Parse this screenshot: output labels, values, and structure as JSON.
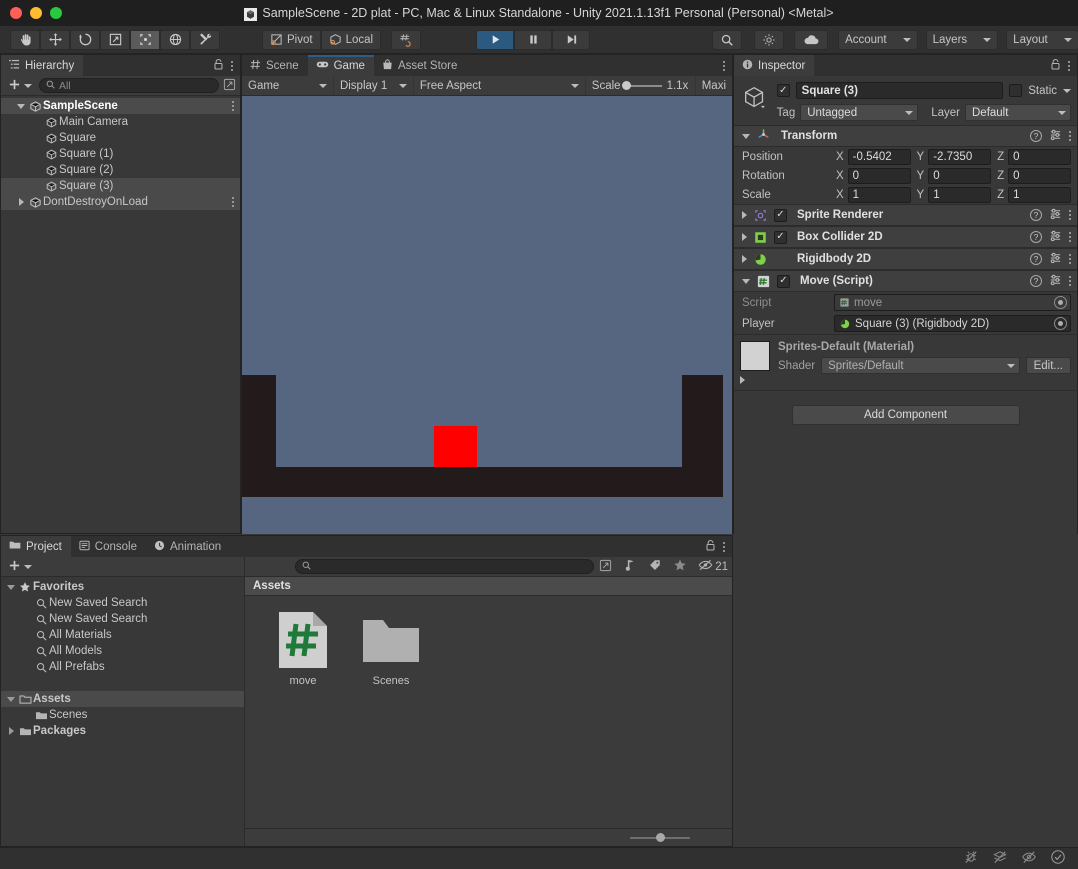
{
  "window": {
    "title": "SampleScene - 2D plat - PC, Mac & Linux Standalone - Unity 2021.1.13f1 Personal (Personal) <Metal>"
  },
  "toolbar": {
    "tools": [
      "hand-tool",
      "move-tool",
      "rotate-tool",
      "scale-tool",
      "rect-tool",
      "transform-tool",
      "custom-tool"
    ],
    "active_tool": "rect-tool",
    "pivot_label": "Pivot",
    "local_label": "Local",
    "snap_label": "grid-snap",
    "play_label": "play",
    "pause_label": "pause",
    "step_label": "step",
    "search_label": "search",
    "layers_label": "Layers",
    "layout_label": "Layout",
    "account_label": "Account",
    "cloud_label": "cloud",
    "services_label": "services"
  },
  "hierarchy": {
    "tab_label": "Hierarchy",
    "search_placeholder": "All",
    "create_label": "+",
    "items": [
      {
        "label": "SampleScene",
        "icon": "unity-scene-icon",
        "depth": 1,
        "expander": "down",
        "selected": true,
        "bold": true,
        "kebab": true
      },
      {
        "label": "Main Camera",
        "icon": "gameobject-icon",
        "depth": 2,
        "expander": "none",
        "selected": false,
        "bold": false,
        "kebab": false
      },
      {
        "label": "Square",
        "icon": "gameobject-icon",
        "depth": 2,
        "expander": "none",
        "selected": false,
        "bold": false,
        "kebab": false
      },
      {
        "label": "Square (1)",
        "icon": "gameobject-icon",
        "depth": 2,
        "expander": "none",
        "selected": false,
        "bold": false,
        "kebab": false
      },
      {
        "label": "Square (2)",
        "icon": "gameobject-icon",
        "depth": 2,
        "expander": "none",
        "selected": false,
        "bold": false,
        "kebab": false
      },
      {
        "label": "Square (3)",
        "icon": "gameobject-icon",
        "depth": 2,
        "expander": "none",
        "selected": true,
        "bold": false,
        "kebab": false
      },
      {
        "label": "DontDestroyOnLoad",
        "icon": "unity-scene-icon",
        "depth": 1,
        "expander": "right",
        "selected": true,
        "bold": false,
        "kebab": true
      }
    ]
  },
  "gameview": {
    "tabs": [
      {
        "label": "Scene",
        "icon": "scene-grid-icon",
        "active": false
      },
      {
        "label": "Game",
        "icon": "gamepad-icon",
        "active": true
      },
      {
        "label": "Asset Store",
        "icon": "store-icon",
        "active": false
      }
    ],
    "controls": {
      "display_mode": "Game",
      "display_number": "Display 1",
      "aspect": "Free Aspect",
      "scale_label": "Scale",
      "scale_value": "1.1x",
      "maximize_label": "Maxi"
    },
    "scene": {
      "background_color": "#566681",
      "platform_color": "#231b1b",
      "player_color": "#ff0000"
    }
  },
  "inspector": {
    "tab_label": "Inspector",
    "object_name": "Square (3)",
    "enabled": true,
    "static_label": "Static",
    "tag_label": "Tag",
    "tag_value": "Untagged",
    "layer_label": "Layer",
    "layer_value": "Default",
    "transform": {
      "title": "Transform",
      "rows": [
        {
          "label": "Position",
          "x": "-0.5402",
          "y": "-2.7350",
          "z": "0"
        },
        {
          "label": "Rotation",
          "x": "0",
          "y": "0",
          "z": "0"
        },
        {
          "label": "Scale",
          "x": "1",
          "y": "1",
          "z": "1"
        }
      ]
    },
    "components": [
      {
        "title": "Sprite Renderer",
        "icon": "sprite-renderer-icon",
        "has_checkbox": true,
        "checked": true,
        "expanded": false
      },
      {
        "title": "Box Collider 2D",
        "icon": "box-collider-2d-icon",
        "has_checkbox": true,
        "checked": true,
        "expanded": false
      },
      {
        "title": "Rigidbody 2D",
        "icon": "rigidbody-2d-icon",
        "has_checkbox": false,
        "checked": false,
        "expanded": false
      },
      {
        "title": "Move (Script)",
        "icon": "csharp-script-icon",
        "has_checkbox": true,
        "checked": true,
        "expanded": true
      }
    ],
    "script_props": [
      {
        "label": "Script",
        "value": "move",
        "icon": "csharp-script-icon",
        "disabled": true
      },
      {
        "label": "Player",
        "value": "Square (3) (Rigidbody 2D)",
        "icon": "rigidbody-2d-icon",
        "disabled": false
      }
    ],
    "material": {
      "title": "Sprites-Default (Material)",
      "shader_label": "Shader",
      "shader_value": "Sprites/Default",
      "edit_label": "Edit..."
    },
    "add_component_label": "Add Component"
  },
  "project": {
    "tabs": [
      {
        "label": "Project",
        "icon": "folder-icon",
        "active": true
      },
      {
        "label": "Console",
        "icon": "console-icon",
        "active": false
      },
      {
        "label": "Animation",
        "icon": "clock-icon",
        "active": false
      }
    ],
    "create_label": "+",
    "search_placeholder": "",
    "hidden_count": "21",
    "breadcrumb": "Assets",
    "tree": [
      {
        "label": "Favorites",
        "icon": "star-icon",
        "depth": 0,
        "expander": "down",
        "bold": true,
        "selected": false
      },
      {
        "label": "New Saved Search",
        "icon": "search-icon",
        "depth": 1,
        "expander": "none",
        "bold": false,
        "selected": false
      },
      {
        "label": "New Saved Search",
        "icon": "search-icon",
        "depth": 1,
        "expander": "none",
        "bold": false,
        "selected": false
      },
      {
        "label": "All Materials",
        "icon": "search-icon",
        "depth": 1,
        "expander": "none",
        "bold": false,
        "selected": false
      },
      {
        "label": "All Models",
        "icon": "search-icon",
        "depth": 1,
        "expander": "none",
        "bold": false,
        "selected": false
      },
      {
        "label": "All Prefabs",
        "icon": "search-icon",
        "depth": 1,
        "expander": "none",
        "bold": false,
        "selected": false
      },
      {
        "label": "",
        "icon": "spacer",
        "depth": 0,
        "expander": "none",
        "bold": false,
        "selected": false
      },
      {
        "label": "Assets",
        "icon": "folder-open-icon",
        "depth": 0,
        "expander": "down",
        "bold": true,
        "selected": true
      },
      {
        "label": "Scenes",
        "icon": "folder-icon",
        "depth": 1,
        "expander": "none",
        "bold": false,
        "selected": false
      },
      {
        "label": "Packages",
        "icon": "folder-icon",
        "depth": 0,
        "expander": "right",
        "bold": true,
        "selected": false
      }
    ],
    "assets": [
      {
        "label": "move",
        "icon": "csharp-file-icon"
      },
      {
        "label": "Scenes",
        "icon": "folder-big-icon"
      }
    ]
  },
  "statusbar": {
    "icons": [
      "bug-muted-icon",
      "stack-muted-icon",
      "eye-off-icon",
      "check-circle-icon"
    ]
  }
}
